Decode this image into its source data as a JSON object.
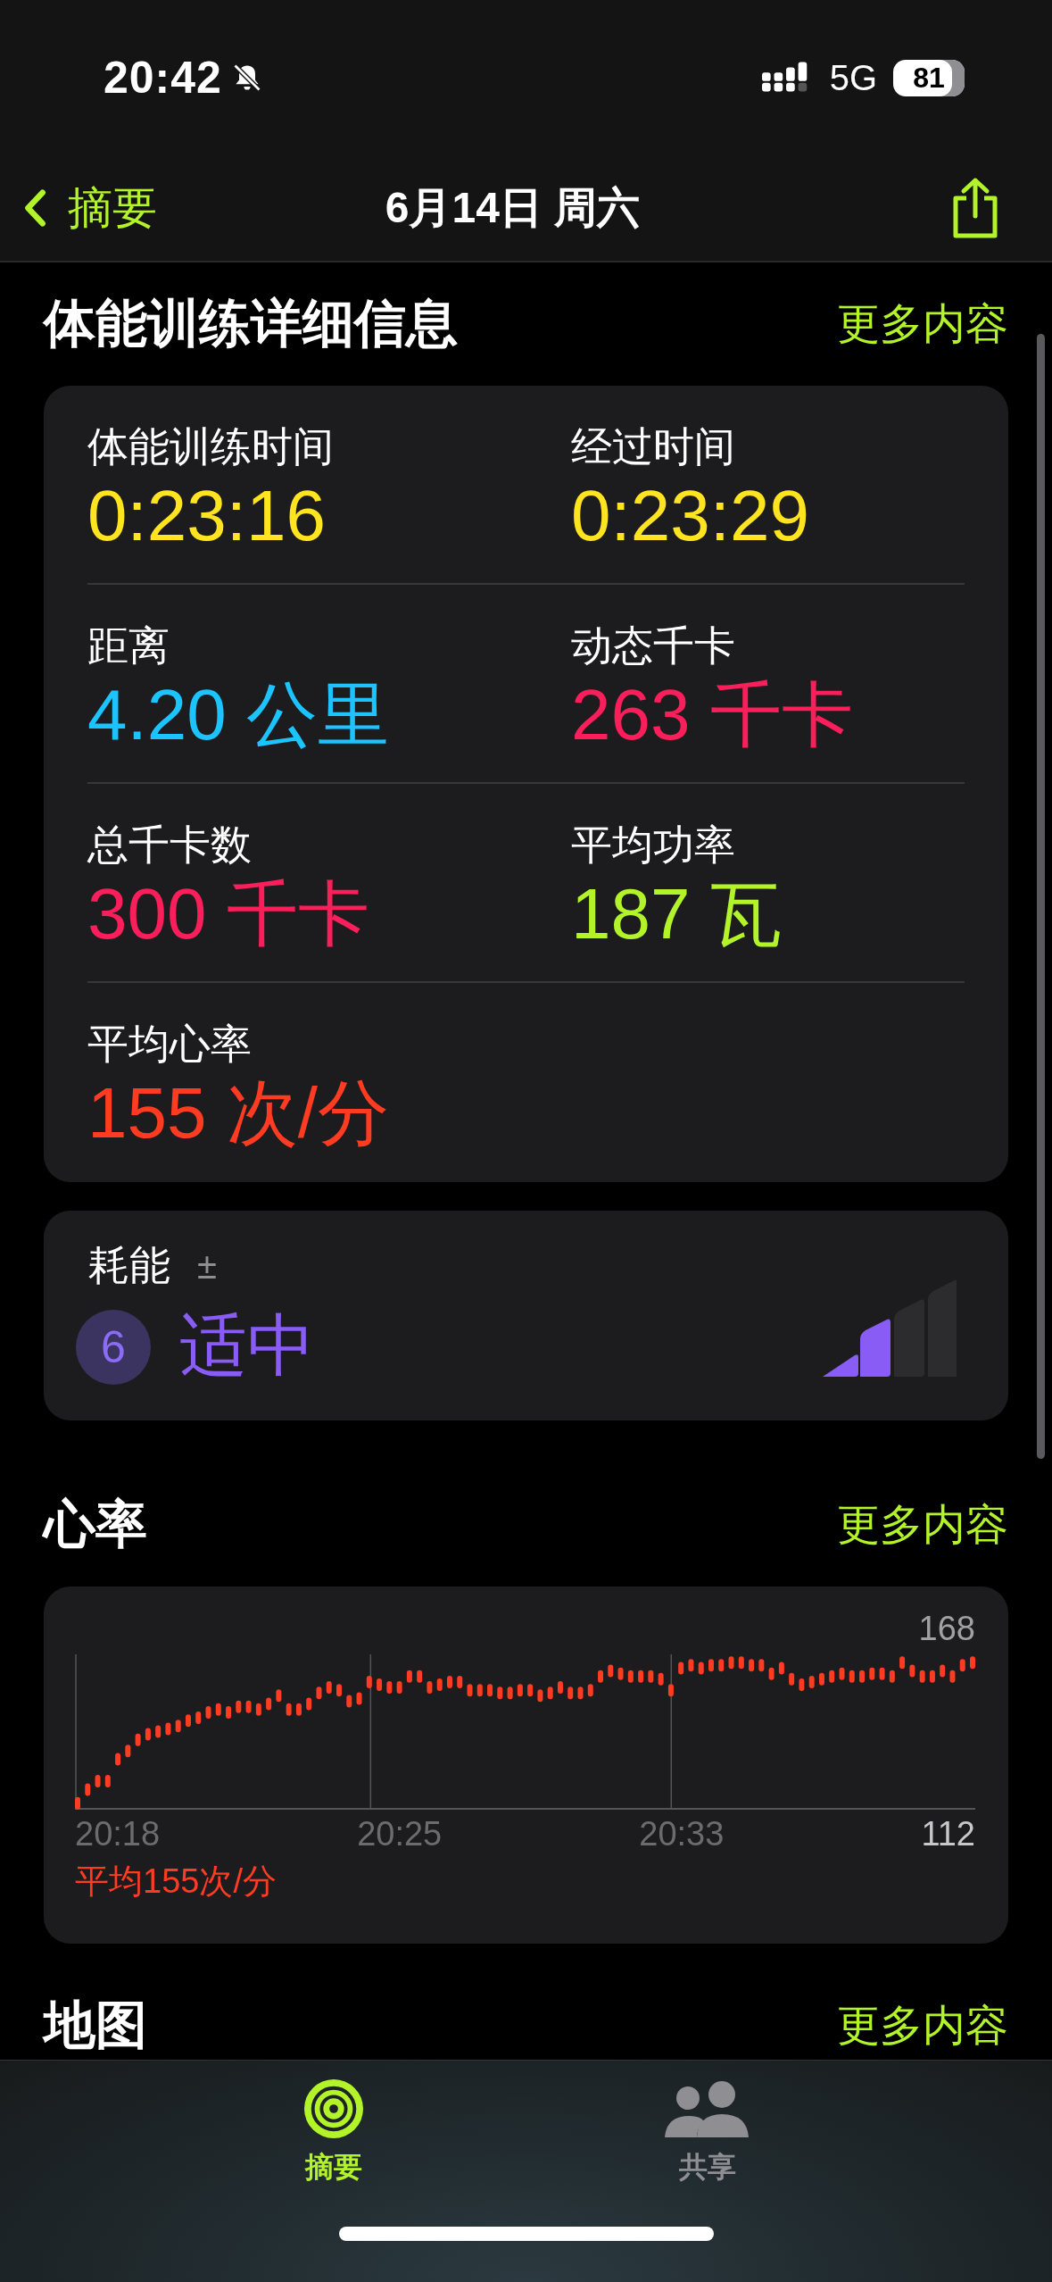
{
  "status_bar": {
    "time": "20:42",
    "network": "5G",
    "battery": "81"
  },
  "nav": {
    "back": "摘要",
    "title": "6月14日 周六"
  },
  "details": {
    "title": "体能训练详细信息",
    "more": "更多内容",
    "rows": [
      [
        {
          "label": "体能训练时间",
          "value": "0:23:16",
          "color": "#ffe41f"
        },
        {
          "label": "经过时间",
          "value": "0:23:29",
          "color": "#ffe41f"
        }
      ],
      [
        {
          "label": "距离",
          "value": "4.20 公里",
          "color": "#1cc4ff"
        },
        {
          "label": "动态千卡",
          "value": "263 千卡",
          "color": "#fa1e5a"
        }
      ],
      [
        {
          "label": "总千卡数",
          "value": "300 千卡",
          "color": "#fa1e5a"
        },
        {
          "label": "平均功率",
          "value": "187 瓦",
          "color": "#b2f329"
        }
      ],
      [
        {
          "label": "平均心率",
          "value": "155 次/分",
          "color": "#ff3b22"
        }
      ]
    ]
  },
  "effort": {
    "label": "耗能",
    "sign": "±",
    "score": "6",
    "rating": "适中",
    "level": 0.5
  },
  "heart": {
    "title": "心率",
    "more": "更多内容",
    "average": "平均155次/分",
    "max": "168",
    "min": "112",
    "times": [
      "20:18",
      "20:25",
      "20:33"
    ]
  },
  "map": {
    "title": "地图",
    "more": "更多内容"
  },
  "tabs": [
    {
      "label": "摘要",
      "selected": true,
      "kind": "rings"
    },
    {
      "label": "共享",
      "selected": false,
      "kind": "people"
    }
  ]
}
